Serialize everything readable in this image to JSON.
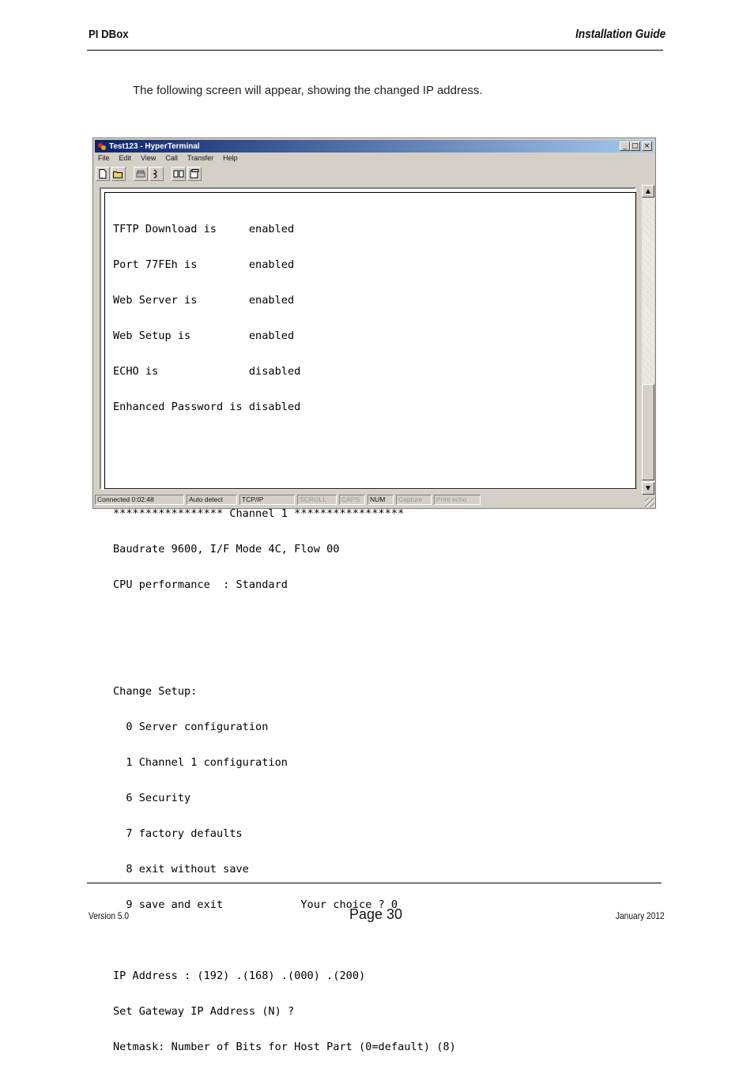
{
  "header": {
    "product": "PI DBox",
    "doc_title": "Installation Guide"
  },
  "intro_text": "The following screen will appear, showing the changed IP address.",
  "window": {
    "title": "Test123 - HyperTerminal",
    "controls": {
      "minimize": "_",
      "maximize": "□",
      "close": "×"
    },
    "menu": [
      "File",
      "Edit",
      "View",
      "Call",
      "Transfer",
      "Help"
    ],
    "toolbar_icons": [
      "new-document-icon",
      "open-folder-icon",
      "connect-phone-icon",
      "disconnect-icon",
      "send-file-icon",
      "properties-icon"
    ],
    "terminal_lines": [
      "TFTP Download is     enabled",
      "Port 77FEh is        enabled",
      "Web Server is        enabled",
      "Web Setup is         enabled",
      "ECHO is              disabled",
      "Enhanced Password is disabled",
      "",
      "",
      "***************** Channel 1 *****************",
      "Baudrate 9600, I/F Mode 4C, Flow 00",
      "CPU performance  : Standard",
      "",
      "",
      "Change Setup:",
      "  0 Server configuration",
      "  1 Channel 1 configuration",
      "  6 Security",
      "  7 factory defaults",
      "  8 exit without save",
      "  9 save and exit            Your choice ? 0",
      "",
      "IP Address : (192) .(168) .(000) .(200)",
      "Set Gateway IP Address (N) ?",
      "Netmask: Number of Bits for Host Part (0=default) (8)"
    ],
    "status": {
      "connected": "Connected 0:02:48",
      "detect": "Auto detect",
      "protocol": "TCP/IP",
      "scroll": "SCROLL",
      "caps": "CAPS",
      "num": "NUM",
      "capture": "Capture",
      "print_echo": "Print echo"
    }
  },
  "footer": {
    "version": "Version 5.0",
    "page": "Page 30",
    "date": "January 2012"
  }
}
